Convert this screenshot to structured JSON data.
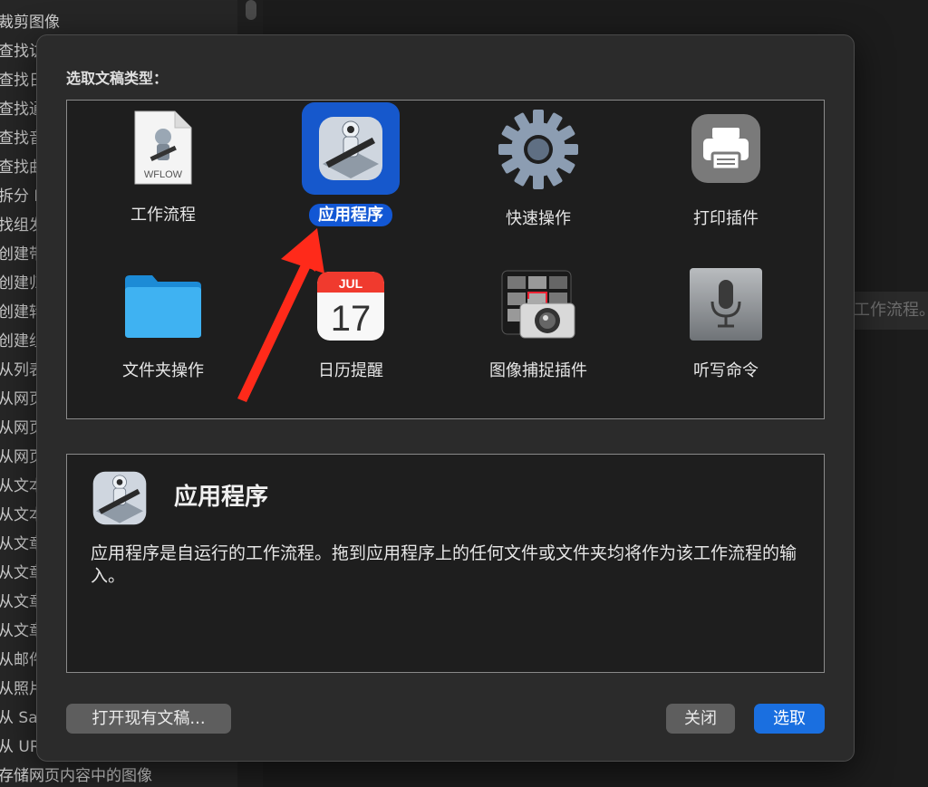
{
  "background": {
    "sidebar_items": [
      "裁剪图像",
      "查找访",
      "查找日",
      "查找通",
      "查找音",
      "查找曲",
      "拆分 P",
      "找组发",
      "创建带",
      "创建归",
      "创建转",
      "创建组",
      "从列表",
      "从网页",
      "从网页",
      "从网页",
      "从文本",
      "从文本",
      "从文章",
      "从文章",
      "从文章",
      "从文章",
      "从邮件",
      "从照片",
      "从 Saf",
      "从 URL",
      "存储网页内容中的图像"
    ],
    "hint_text": "工作流程。"
  },
  "dialog": {
    "title": "选取文稿类型：",
    "types": [
      {
        "label": "工作流程",
        "icon": "workflow-file-icon",
        "badge": "WFLOW"
      },
      {
        "label": "应用程序",
        "icon": "automator-robot-icon",
        "selected": true
      },
      {
        "label": "快速操作",
        "icon": "gear-icon"
      },
      {
        "label": "打印插件",
        "icon": "printer-icon"
      },
      {
        "label": "文件夹操作",
        "icon": "folder-icon"
      },
      {
        "label": "日历提醒",
        "icon": "calendar-icon",
        "month": "JUL",
        "day": "17"
      },
      {
        "label": "图像捕捉插件",
        "icon": "image-capture-icon"
      },
      {
        "label": "听写命令",
        "icon": "microphone-icon"
      }
    ],
    "description": {
      "title": "应用程序",
      "text": "应用程序是自运行的工作流程。拖到应用程序上的任何文件或文件夹均将作为该工作流程的输入。"
    },
    "buttons": {
      "open_existing": "打开现有文稿...",
      "close": "关闭",
      "choose": "选取"
    }
  },
  "colors": {
    "accent": "#1a6fe0",
    "selection": "#1658cc",
    "arrow": "#ff2a1a"
  }
}
